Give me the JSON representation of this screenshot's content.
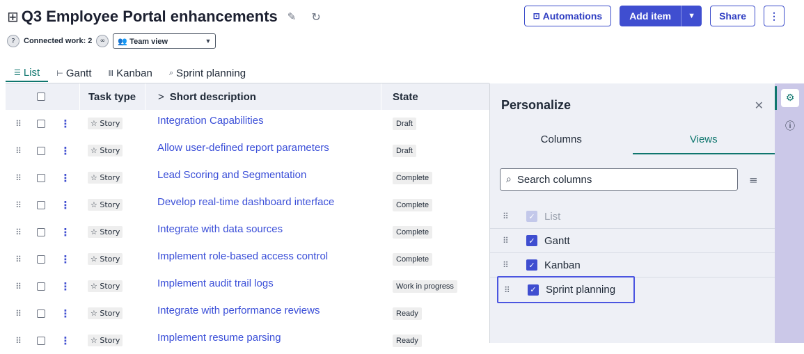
{
  "header": {
    "title": "Q3 Employee Portal enhancements",
    "connected_work": "Connected work: 2",
    "view_selected": "Team view"
  },
  "actions": {
    "automations": "Automations",
    "add_item": "Add item",
    "share": "Share"
  },
  "tabs": [
    {
      "label": "List"
    },
    {
      "label": "Gantt"
    },
    {
      "label": "Kanban"
    },
    {
      "label": "Sprint planning"
    }
  ],
  "table": {
    "columns": {
      "task_type": "Task type",
      "short_description": "Short description",
      "state": "State"
    },
    "rows": [
      {
        "type": "Story",
        "desc": "Integration Capabilities",
        "state": "Draft"
      },
      {
        "type": "Story",
        "desc": "Allow user-defined report parameters",
        "state": "Draft"
      },
      {
        "type": "Story",
        "desc": "Lead Scoring and Segmentation",
        "state": "Complete"
      },
      {
        "type": "Story",
        "desc": "Develop real-time dashboard interface",
        "state": "Complete"
      },
      {
        "type": "Story",
        "desc": "Integrate with data sources",
        "state": "Complete"
      },
      {
        "type": "Story",
        "desc": "Implement role-based access control",
        "state": "Complete"
      },
      {
        "type": "Story",
        "desc": "Implement audit trail logs",
        "state": "Work in progress"
      },
      {
        "type": "Story",
        "desc": "Integrate with performance reviews",
        "state": "Ready"
      },
      {
        "type": "Story",
        "desc": "Implement resume parsing",
        "state": "Ready"
      }
    ]
  },
  "panel": {
    "title": "Personalize",
    "tabs": [
      "Columns",
      "Views"
    ],
    "search_placeholder": "Search columns",
    "views": [
      {
        "label": "List",
        "checked": true,
        "disabled": true
      },
      {
        "label": "Gantt",
        "checked": true,
        "disabled": false
      },
      {
        "label": "Kanban",
        "checked": true,
        "disabled": false
      },
      {
        "label": "Sprint planning",
        "checked": true,
        "disabled": false
      }
    ]
  },
  "colors": {
    "primary": "#3f4ed0",
    "accent_teal": "#0f766e",
    "link": "#3b4fd8",
    "rail": "#cbc8e8"
  },
  "icons": [
    "app-grid-icon",
    "edit-icon",
    "refresh-icon",
    "help-circle-icon",
    "binoculars-icon",
    "team-icon",
    "robot-icon",
    "chevron-down-icon",
    "more-vertical-icon",
    "list-icon",
    "gantt-icon",
    "kanban-icon",
    "sprint-icon",
    "drag-handle-icon",
    "star-icon",
    "close-icon",
    "search-icon",
    "settings-icon",
    "info-icon"
  ]
}
